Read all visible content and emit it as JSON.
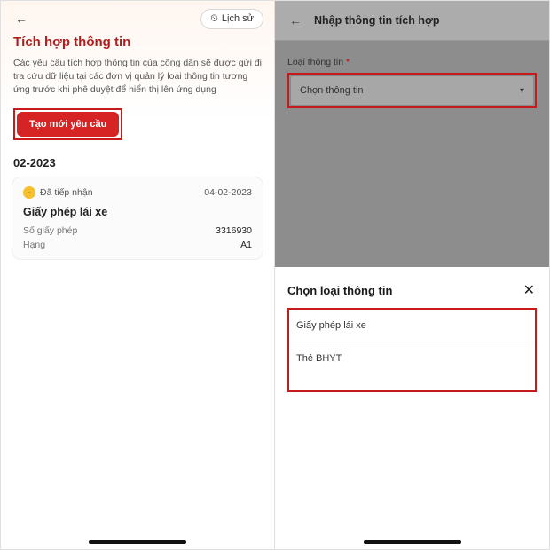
{
  "left": {
    "history_label": "Lịch sử",
    "title": "Tích hợp thông tin",
    "description": "Các yêu cầu tích hợp thông tin của công dân sẽ được gửi đi tra cứu dữ liệu tại các đơn vị quản lý loại thông tin tương ứng trước khi phê duyệt để hiển thị lên ứng dụng",
    "create_button": "Tạo mới yêu cầu",
    "month_section": "02-2023",
    "card": {
      "status": "Đã tiếp nhận",
      "date": "04-02-2023",
      "title": "Giấy phép lái xe",
      "license_no_label": "Số giấy phép",
      "license_no_value": "3316930",
      "class_label": "Hạng",
      "class_value": "A1"
    }
  },
  "right": {
    "title": "Nhập thông tin tích hợp",
    "field_label": "Loại thông tin",
    "field_required_mark": "*",
    "field_placeholder": "Chọn thông tin",
    "sheet": {
      "title": "Chọn loại thông tin",
      "options": {
        "0": "Giấy phép lái xe",
        "1": "Thẻ BHYT"
      }
    }
  }
}
